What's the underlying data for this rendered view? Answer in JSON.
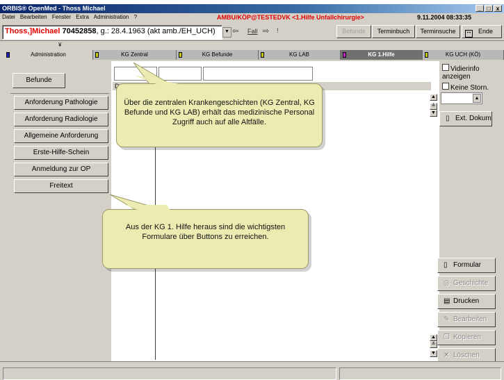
{
  "window": {
    "title": "ORBIS® OpenMed - Thoss Michael",
    "controls": [
      "_",
      "□",
      "x"
    ]
  },
  "menu": {
    "items": [
      "Datei",
      "Bearbeiten",
      "Fenster",
      "Extra",
      "Administration",
      "?"
    ],
    "status": "AMBU/KÖP@TESTEDVK <1.Hilfe Unfallchirurgie>",
    "datetime": "9.11.2004 08:33:35"
  },
  "toolbar": {
    "patient_name": "Thoss,]Michael",
    "patient_id": "70452858",
    "patient_rest": ", g.: 28.4.1963 (akt amb./EH_UCH)",
    "fall_label": "Fall",
    "befunde_label": "Befunde",
    "terminbuch_label": "Terminbuch",
    "terminsuche_label": "Terminsuche",
    "ende_label": "Ende"
  },
  "tabs": [
    {
      "label": "Administration",
      "marker": "#2020c0"
    },
    {
      "label": "KG Zentral",
      "marker": "#c8c800"
    },
    {
      "label": "KG Befunde",
      "marker": "#c8c800"
    },
    {
      "label": "KG LAB",
      "marker": "#c8c800"
    },
    {
      "label": "KG 1.Hilfe",
      "marker": "#c020c0"
    },
    {
      "label": "KG UCH (KÖ)",
      "marker": "#c8c800"
    }
  ],
  "left": {
    "befunde": "Befunde",
    "buttons": [
      "Anforderung Pathologie",
      "Anforderung Radiologie",
      "Allgemeine Anforderung",
      "Erste-Hilfe-Schein",
      "Anmeldung zur OP",
      "Freitext"
    ]
  },
  "main": {
    "column_header": "Da"
  },
  "right": {
    "vidierinfo": "Vidierinfo anzeigen",
    "keine_storn": "Keine Storn.",
    "ext_dokum": "Ext. Dokum",
    "buttons": [
      {
        "label": "Formular",
        "icon": "document-icon",
        "enabled": true
      },
      {
        "label": "Geschichte",
        "icon": "history-icon",
        "enabled": false
      },
      {
        "label": "Drucken",
        "icon": "printer-icon",
        "enabled": true
      },
      {
        "label": "Bearbeiten",
        "icon": "edit-icon",
        "enabled": false
      },
      {
        "label": "Kopieren",
        "icon": "copy-icon",
        "enabled": false
      },
      {
        "label": "Löschen",
        "icon": "delete-icon",
        "enabled": false
      }
    ]
  },
  "callouts": {
    "kg": "Über die zentralen Krankengeschichten (KG Zentral, KG Befunde und KG LAB) erhält das medizinische Personal Zugriff auch auf alle Altfälle.",
    "forms": "Aus der KG 1. Hilfe heraus sind die wichtigsten Formulare über Buttons zu erreichen."
  },
  "colors": {
    "accent_red": "#e00000",
    "callout_fill": "#ecebb2",
    "window_bg": "#d4d0c8"
  }
}
